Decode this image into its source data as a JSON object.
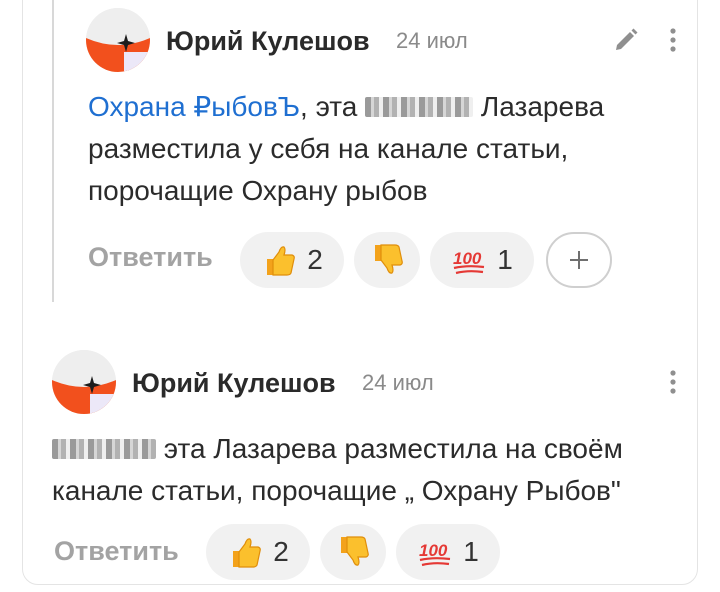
{
  "comments": [
    {
      "author": "Юрий Кулешов",
      "date": "24 июл",
      "mention": "Охрана ₽ыбовЪ",
      "text_before": ", эта ",
      "text_after": " Лазарева",
      "line2": "разместила у себя на канале статьи,",
      "line3": "порочащие Охрану рыбов",
      "reply_label": "Ответить",
      "reactions": [
        {
          "icon": "thumbs-up-icon",
          "count": "2"
        },
        {
          "icon": "thumbs-down-icon",
          "count": ""
        },
        {
          "icon": "hundred-points-icon",
          "count": "1"
        }
      ],
      "add_reaction": "plus-icon"
    },
    {
      "author": "Юрий Кулешов",
      "date": "24 июл",
      "line1_after": " эта Лазарева разместила на своём",
      "line2": "канале статьи, порочащие „ Охрану Рыбов\"",
      "reply_label": "Ответить",
      "reactions": [
        {
          "icon": "thumbs-up-icon",
          "count": "2"
        },
        {
          "icon": "thumbs-down-icon",
          "count": ""
        },
        {
          "icon": "hundred-points-icon",
          "count": "1"
        }
      ]
    }
  ],
  "colors": {
    "mention": "#1f6fd1",
    "avatar_red": "#f2501d",
    "reply_gray": "#a3a3a3"
  }
}
